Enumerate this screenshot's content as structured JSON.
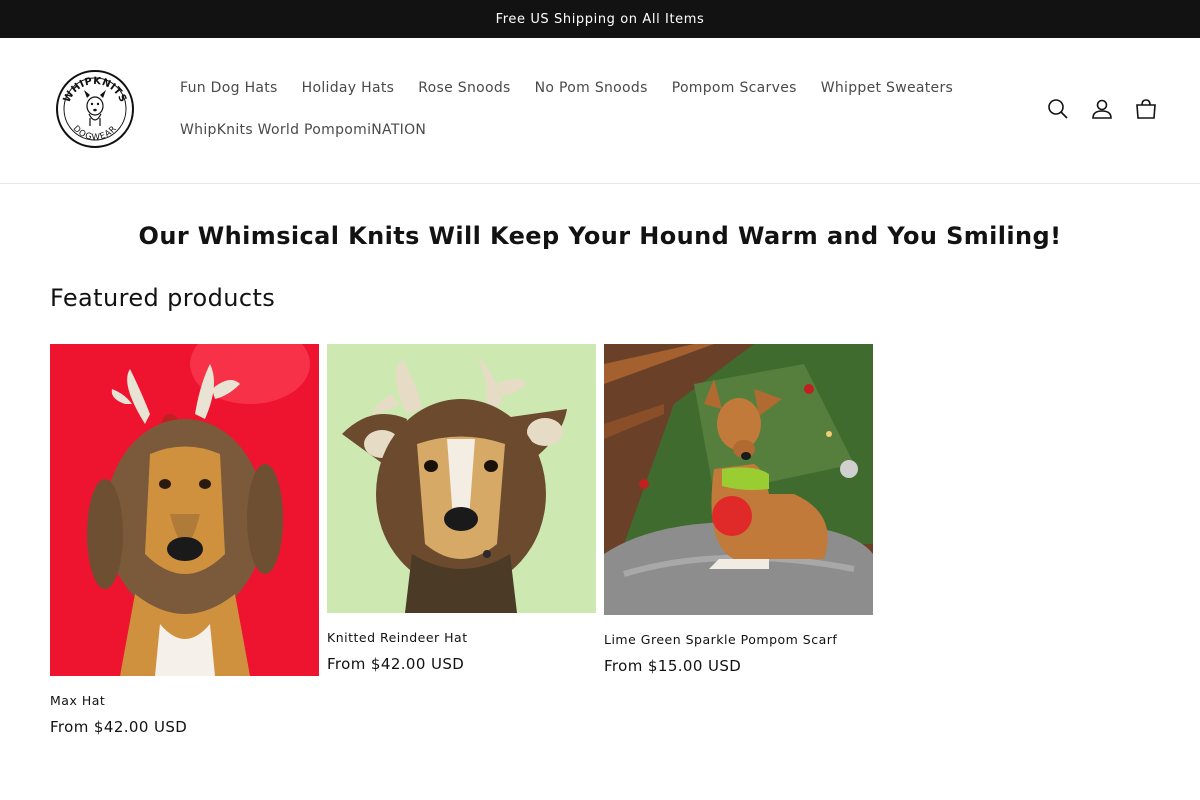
{
  "announcement": {
    "text": "Free US Shipping on All Items"
  },
  "header": {
    "logo": {
      "top_text": "WHIPKNITS",
      "bottom_text": "DOGWEAR"
    },
    "nav_row1": [
      {
        "label": "Fun Dog Hats"
      },
      {
        "label": "Holiday Hats"
      },
      {
        "label": "Rose Snoods"
      },
      {
        "label": "No Pom Snoods"
      },
      {
        "label": "Pompom Scarves"
      },
      {
        "label": "Whippet Sweaters"
      }
    ],
    "nav_row2": [
      {
        "label": "WhipKnits World PompomiNATION"
      }
    ],
    "icons": [
      "search-icon",
      "account-icon",
      "cart-icon"
    ]
  },
  "main": {
    "headline": "Our Whimsical Knits Will Keep Your Hound Warm and You Smiling!",
    "section_title": "Featured products",
    "products": [
      {
        "title": "Max Hat",
        "price": "From $42.00 USD",
        "image": "red background, dog in brown knit antler hood with floppy ears"
      },
      {
        "title": "Knitted Reindeer Hat",
        "price": "From $42.00 USD",
        "image": "pale green background, dog in brown knit reindeer hood"
      },
      {
        "title": "Lime Green Sparkle Pompom Scarf",
        "price": "From $15.00 USD",
        "image": "dog by christmas tree wearing lime green scarf with red pompom"
      }
    ]
  },
  "colors": {
    "announcement_bg": "#121212",
    "text": "#121212",
    "nav_text": "#4a4a4a",
    "product1_bg": "#ee1430",
    "product2_bg": "#cde8b0"
  }
}
